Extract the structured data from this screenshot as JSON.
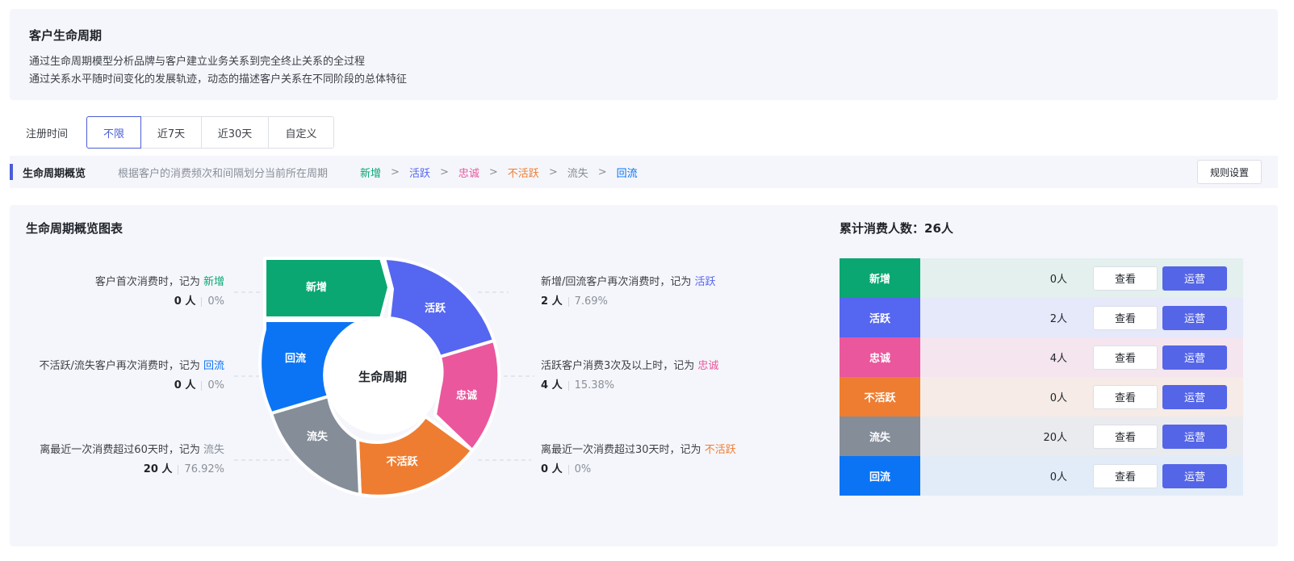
{
  "intro": {
    "title": "客户生命周期",
    "line1": "通过生命周期模型分析品牌与客户建立业务关系到完全终止关系的全过程",
    "line2": "通过关系水平随时间变化的发展轨迹，动态的描述客户关系在不同阶段的总体特征"
  },
  "filter": {
    "label": "注册时间",
    "options": [
      "不限",
      "近7天",
      "近30天",
      "自定义"
    ],
    "selected": "不限"
  },
  "overview": {
    "title": "生命周期概览",
    "desc": "根据客户的消费频次和间隔划分当前所在周期",
    "arrow": ">",
    "flow": [
      "新增",
      "活跃",
      "忠诚",
      "不活跃",
      "流失",
      "回流"
    ],
    "rule_button": "规则设置"
  },
  "chart_panel": {
    "title": "生命周期概览图表",
    "total_label": "累计消费人数：26人",
    "center_label": "生命周期",
    "annotations": {
      "xinzeng": {
        "text": "客户首次消费时，记为",
        "stage": "新增",
        "count": "0 人",
        "pct": "0%"
      },
      "huoyue": {
        "text": "新增/回流客户再次消费时，记为",
        "stage": "活跃",
        "count": "2 人",
        "pct": "7.69%"
      },
      "huiliu": {
        "text": "不活跃/流失客户再次消费时，记为",
        "stage": "回流",
        "count": "0 人",
        "pct": "0%"
      },
      "zhongcheng": {
        "text": "活跃客户消费3次及以上时，记为",
        "stage": "忠诚",
        "count": "4 人",
        "pct": "15.38%"
      },
      "liushi": {
        "text": "离最近一次消费超过60天时，记为",
        "stage": "流失",
        "count": "20 人",
        "pct": "76.92%"
      },
      "buhuoyue": {
        "text": "离最近一次消费超过30天时，记为",
        "stage": "不活跃",
        "count": "0 人",
        "pct": "0%"
      }
    }
  },
  "stats": [
    {
      "name": "新增",
      "count": "0人",
      "view": "查看",
      "op": "运营"
    },
    {
      "name": "活跃",
      "count": "2人",
      "view": "查看",
      "op": "运营"
    },
    {
      "name": "忠诚",
      "count": "4人",
      "view": "查看",
      "op": "运营"
    },
    {
      "name": "不活跃",
      "count": "0人",
      "view": "查看",
      "op": "运营"
    },
    {
      "name": "流失",
      "count": "20人",
      "view": "查看",
      "op": "运营"
    },
    {
      "name": "回流",
      "count": "0人",
      "view": "查看",
      "op": "运营"
    }
  ],
  "colors": {
    "新增": "#0aa772",
    "活跃": "#5566f0",
    "忠诚": "#ea579d",
    "不活跃": "#ee7d31",
    "流失": "#858d99",
    "回流": "#0b74f5",
    "新增_bg": "#e3f0ee",
    "活跃_bg": "#e6e9fa",
    "忠诚_bg": "#f4e5ef",
    "不活跃_bg": "#f6ebe6",
    "流失_bg": "#eaebee",
    "回流_bg": "#e2ecf8",
    "accent": "#4b5dd6",
    "operate": "#5465e8"
  }
}
